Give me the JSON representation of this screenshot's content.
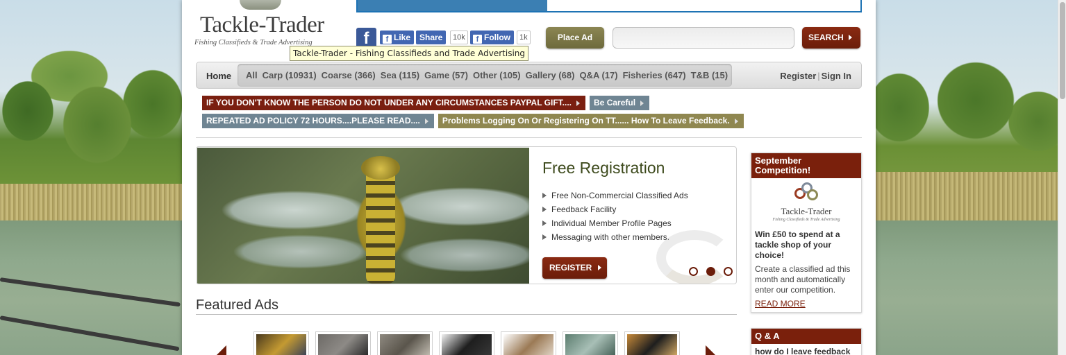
{
  "logo": {
    "name": "Tackle-Trader",
    "tagline": "Fishing Classifieds & Trade Advertising"
  },
  "social": {
    "fb_icon": "facebook-icon",
    "like_label": "Like",
    "share_label": "Share",
    "share_count": "10k",
    "follow_label": "Follow",
    "follow_count": "1k"
  },
  "header": {
    "place_ad_label": "Place Ad",
    "search_value": "",
    "search_button_label": "SEARCH"
  },
  "tooltip": "Tackle-Trader - Fishing Classifieds and Trade Advertising",
  "nav": {
    "home_label": "Home",
    "categories": [
      "All",
      "Carp (10931)",
      "Coarse (366)",
      "Sea (115)",
      "Game (57)",
      "Other (105)",
      "Gallery (68)",
      "Q&A (17)",
      "Fisheries (647)",
      "T&B (15)"
    ],
    "register_label": "Register",
    "separator": "|",
    "signin_label": "Sign In"
  },
  "notices": {
    "row1": [
      {
        "text": "IF YOU DON'T KNOW THE PERSON DO NOT UNDER ANY CIRCUMSTANCES PAYPAL GIFT....",
        "color": "#7a1f10"
      },
      {
        "text": "Be Careful",
        "color": "#6f8593"
      }
    ],
    "row2": [
      {
        "text": "REPEATED AD POLICY 72 HOURS....PLEASE READ....",
        "color": "#6f8593"
      },
      {
        "text": "Problems Logging On Or Registering On TT...... How To Leave Feedback.",
        "color": "#8f8750"
      }
    ]
  },
  "hero": {
    "title": "Free Registration",
    "features": [
      "Free Non-Commercial Classified Ads",
      "Feedback Facility",
      "Individual Member Profile Pages",
      "Messaging with other members."
    ],
    "register_label": "REGISTER",
    "slide_count": 3,
    "active_slide": 2
  },
  "featured": {
    "title": "Featured Ads",
    "thumbnails": [
      {
        "name": "featured-ad-1",
        "colors": [
          "#4a3a1e",
          "#c49a32",
          "#2f3b5a"
        ]
      },
      {
        "name": "featured-ad-2",
        "colors": [
          "#6d6a66",
          "#8d8a86",
          "#222222"
        ]
      },
      {
        "name": "featured-ad-3",
        "colors": [
          "#8f8a80",
          "#5a554c",
          "#c9c4b8"
        ]
      },
      {
        "name": "featured-ad-4",
        "colors": [
          "#f2f2f2",
          "#1e1e1e",
          "#3a3a3a"
        ]
      },
      {
        "name": "featured-ad-5",
        "colors": [
          "#ffffff",
          "#9b7a55",
          "#e6dccf"
        ]
      },
      {
        "name": "featured-ad-6",
        "colors": [
          "#5c7d6f",
          "#a8bfb6",
          "#3f5a50"
        ]
      },
      {
        "name": "featured-ad-7",
        "colors": [
          "#c78a3a",
          "#1e1e1e",
          "#e0b36a"
        ]
      }
    ]
  },
  "sidebar": {
    "competition": {
      "title": "September Competition!",
      "logo_name": "Tackle-Trader",
      "logo_tagline": "Fishing Classifieds & Trade Advertising",
      "headline": "Win £50 to spend at a tackle shop of your choice!",
      "body": "Create a classified ad this month and automatically enter our competition.",
      "link": "READ MORE"
    },
    "qa": {
      "title": "Q & A",
      "first_item": "how do I leave feedback"
    }
  },
  "colors": {
    "brand_red": "#6b1d0a",
    "brand_olive": "#7b7645",
    "facebook_blue": "#4267b2"
  }
}
